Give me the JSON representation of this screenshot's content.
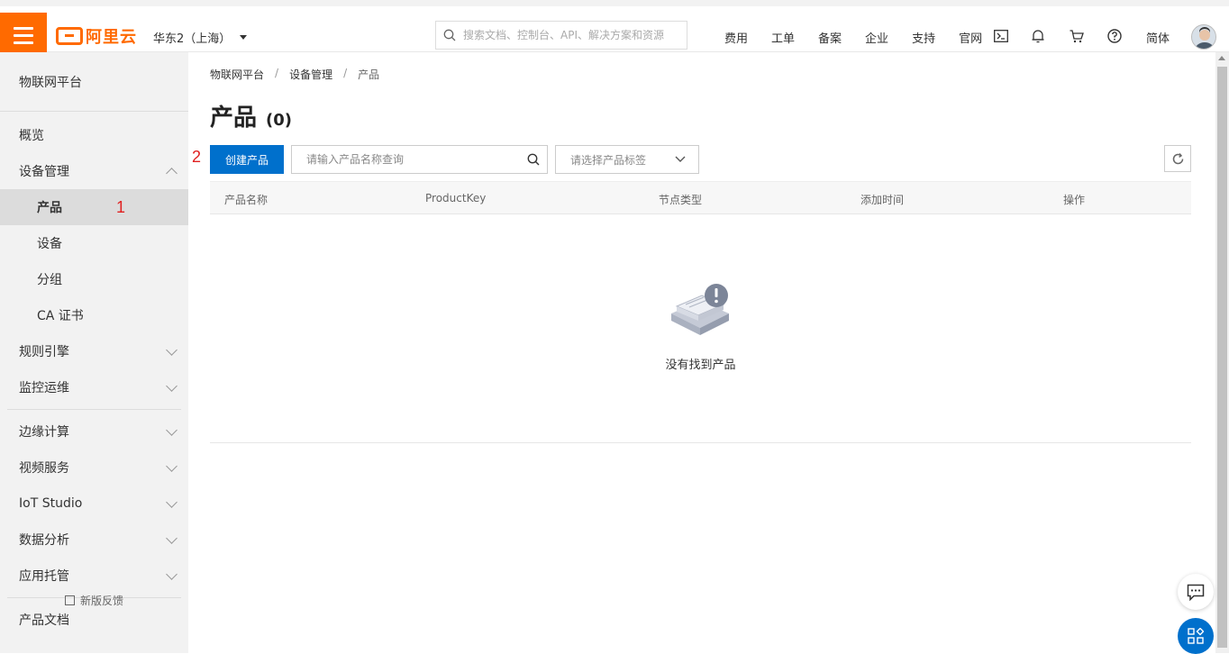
{
  "header": {
    "logo_text": "阿里云",
    "region": "华东2（上海）",
    "search_placeholder": "搜索文档、控制台、API、解决方案和资源",
    "nav": [
      "费用",
      "工单",
      "备案",
      "企业",
      "支持",
      "官网"
    ],
    "icons": [
      "terminal-icon",
      "bell-icon",
      "cart-icon",
      "help-icon"
    ],
    "lang": "简体"
  },
  "sidebar": {
    "title": "物联网平台",
    "overview": "概览",
    "device_mgmt": "设备管理",
    "sub_items": [
      "产品",
      "设备",
      "分组",
      "CA 证书"
    ],
    "annotation_1": "1",
    "groups_a": [
      "规则引擎",
      "监控运维"
    ],
    "groups_b": [
      "边缘计算",
      "视频服务",
      "IoT Studio",
      "数据分析",
      "应用托管"
    ],
    "docs": "产品文档",
    "feedback": "新版反馈"
  },
  "main": {
    "breadcrumb": [
      "物联网平台",
      "设备管理",
      "产品"
    ],
    "breadcrumb_sep": "/",
    "title": "产品",
    "count": "(0)",
    "annotation_2": "2",
    "create_button": "创建产品",
    "search_placeholder": "请输入产品名称查询",
    "tag_placeholder": "请选择产品标签",
    "columns": [
      "产品名称",
      "ProductKey",
      "节点类型",
      "添加时间",
      "操作"
    ],
    "empty_text": "没有找到产品"
  },
  "colors": {
    "brand": "#ff6a00",
    "primary": "#0070cc",
    "annotation": "#e02020"
  }
}
